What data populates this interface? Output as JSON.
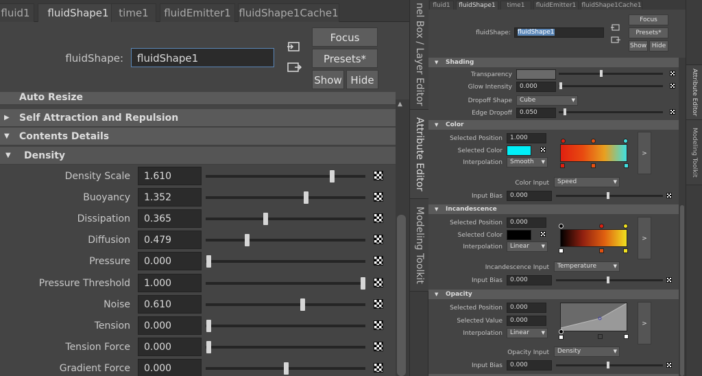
{
  "left": {
    "tabs": [
      "fluid1",
      "fluidShape1",
      "time1",
      "fluidEmitter1",
      "fluidShape1Cache1"
    ],
    "active_tab": "fluidShape1",
    "node_label": "fluidShape:",
    "node_value": "fluidShape1",
    "buttons": {
      "focus": "Focus",
      "presets": "Presets*",
      "show": "Show",
      "hide": "Hide"
    },
    "sections": {
      "auto_resize": "Auto Resize",
      "self_attraction": "Self Attraction and Repulsion",
      "contents_details": "Contents Details",
      "density": "Density"
    },
    "rows": [
      {
        "label": "Density Scale",
        "value": "1.610",
        "slider": 0.8
      },
      {
        "label": "Buoyancy",
        "value": "1.352",
        "slider": 0.63
      },
      {
        "label": "Dissipation",
        "value": "0.365",
        "slider": 0.37
      },
      {
        "label": "Diffusion",
        "value": "0.479",
        "slider": 0.25
      },
      {
        "label": "Pressure",
        "value": "0.000",
        "slider": 0.0
      },
      {
        "label": "Pressure Threshold",
        "value": "1.000",
        "slider": 1.0
      },
      {
        "label": "Noise",
        "value": "0.610",
        "slider": 0.61
      },
      {
        "label": "Tension",
        "value": "0.000",
        "slider": 0.0
      },
      {
        "label": "Tension Force",
        "value": "0.000",
        "slider": 0.0
      },
      {
        "label": "Gradient Force",
        "value": "0.000",
        "slider": 0.5
      }
    ]
  },
  "vertical_tabs": {
    "channel_box": "nel Box / Layer Editor",
    "attribute_editor": "Attribute Editor",
    "modeling_toolkit": "Modeling Toolkit"
  },
  "right": {
    "tabs": [
      "fluid1",
      "fluidShape1",
      "time1",
      "fluidEmitter1",
      "fluidShape1Cache1"
    ],
    "active_tab": "fluidShape1",
    "node_label": "fluidShape:",
    "node_value": "fluidShape1",
    "buttons": {
      "focus": "Focus",
      "presets": "Presets*",
      "show": "Show",
      "hide": "Hide"
    },
    "shading": {
      "title": "Shading",
      "transparency_label": "Transparency",
      "glow_label": "Glow Intensity",
      "glow_value": "0.000",
      "dropoff_label": "Dropoff Shape",
      "dropoff_value": "Cube",
      "edge_label": "Edge Dropoff",
      "edge_value": "0.050"
    },
    "color": {
      "title": "Color",
      "selected_position_label": "Selected Position",
      "selected_position_value": "1.000",
      "selected_color_label": "Selected Color",
      "selected_color": "#00f0f8",
      "interpolation_label": "Interpolation",
      "interpolation_value": "Smooth",
      "input_label": "Color Input",
      "input_value": "Speed",
      "bias_label": "Input Bias",
      "bias_value": "0.000",
      "more": ">"
    },
    "incandescence": {
      "title": "Incandescence",
      "selected_position_label": "Selected Position",
      "selected_position_value": "0.000",
      "selected_color_label": "Selected Color",
      "selected_color": "#000000",
      "interpolation_label": "Interpolation",
      "interpolation_value": "Linear",
      "input_label": "Incandescence Input",
      "input_value": "Temperature",
      "bias_label": "Input Bias",
      "bias_value": "0.000",
      "more": ">"
    },
    "opacity": {
      "title": "Opacity",
      "selected_position_label": "Selected Position",
      "selected_position_value": "0.000",
      "selected_value_label": "Selected Value",
      "selected_value_value": "0.000",
      "interpolation_label": "Interpolation",
      "interpolation_value": "Linear",
      "input_label": "Opacity Input",
      "input_value": "Density",
      "bias_label": "Input Bias",
      "bias_value": "0.000",
      "more": ">"
    }
  },
  "right_strip": {
    "attribute_editor": "Attribute Editor",
    "modeling_toolkit": "Modeling Toolkit"
  }
}
